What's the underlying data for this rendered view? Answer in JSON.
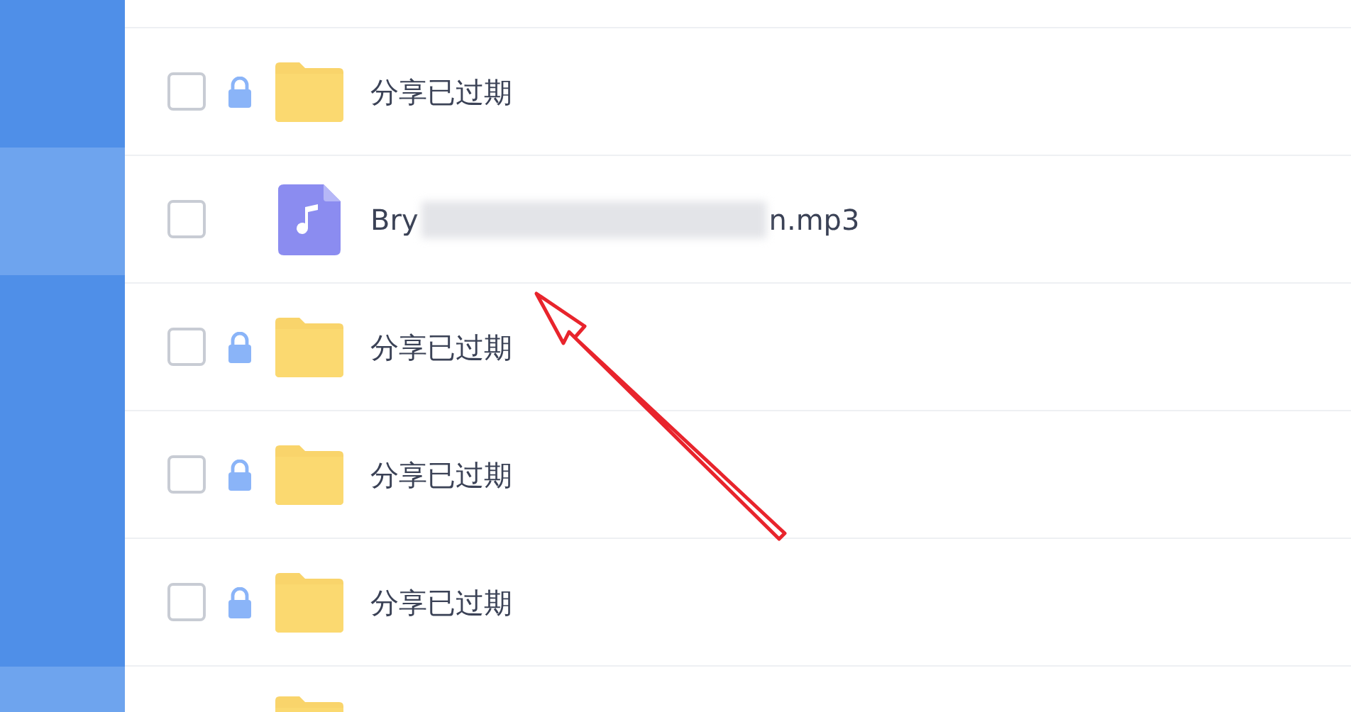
{
  "sidebar": {
    "items": [
      {
        "selected": false
      },
      {
        "selected": true
      },
      {
        "selected": false
      },
      {
        "selected": false
      },
      {
        "selected": false
      },
      {
        "selected": true
      }
    ]
  },
  "files": [
    {
      "kind": "folder",
      "locked": true,
      "checked": false,
      "name": "分享已过期"
    },
    {
      "kind": "audio",
      "locked": false,
      "checked": false,
      "name_start": "Bry",
      "name_end": "n.mp3"
    },
    {
      "kind": "folder",
      "locked": true,
      "checked": false,
      "name": "分享已过期"
    },
    {
      "kind": "folder",
      "locked": true,
      "checked": false,
      "name": "分享已过期"
    },
    {
      "kind": "folder",
      "locked": true,
      "checked": false,
      "name": "分享已过期"
    }
  ],
  "partial_row": {
    "kind": "folder"
  },
  "annotation": {
    "kind": "arrow"
  }
}
